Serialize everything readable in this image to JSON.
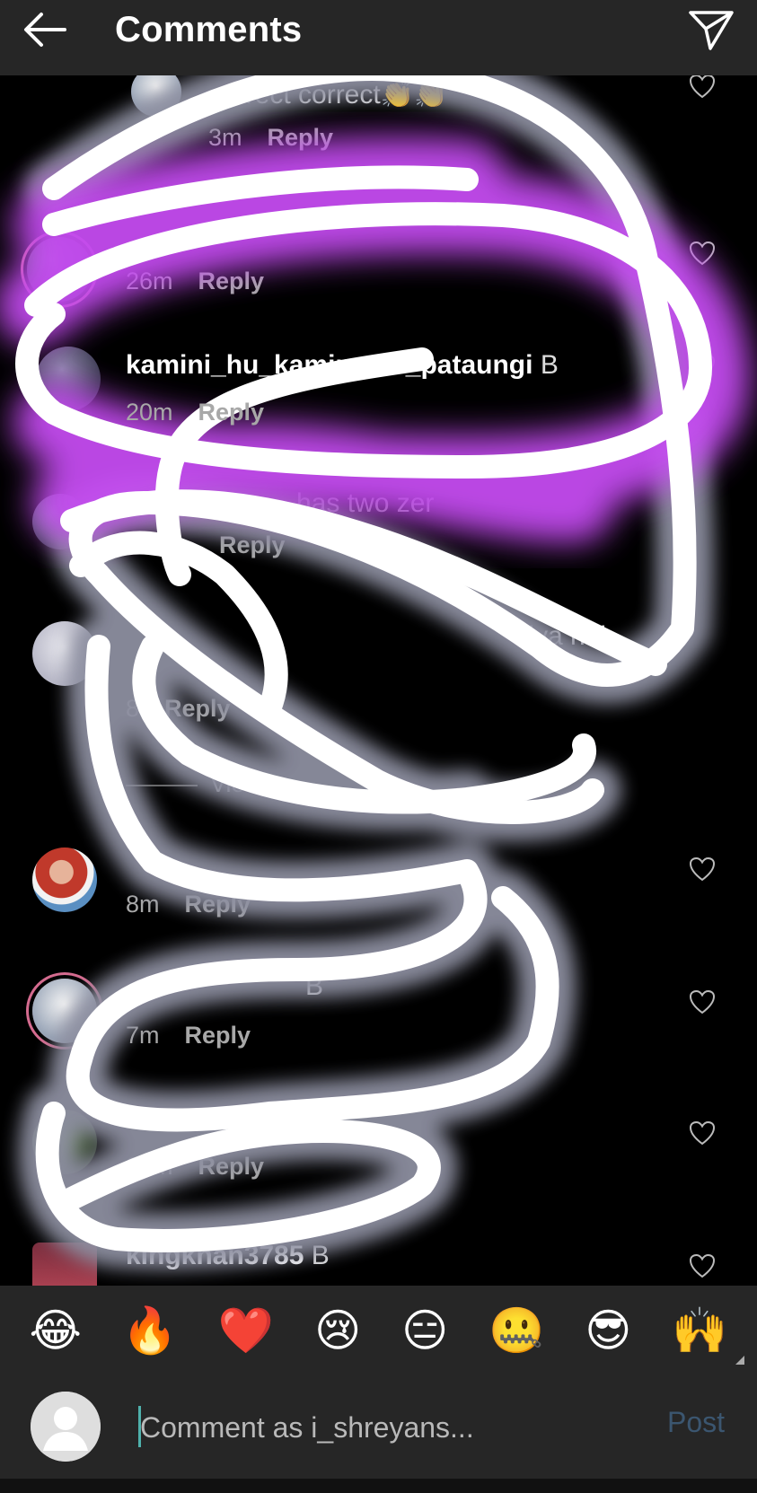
{
  "header": {
    "title": "Comments",
    "back_icon": "back-arrow-icon",
    "share_icon": "send-icon"
  },
  "comments": [
    {
      "username": "",
      "text": "correct correct👏👏",
      "time": "3m",
      "reply": "Reply"
    },
    {
      "username": "",
      "text": "",
      "time": "26m",
      "reply": "Reply"
    },
    {
      "username": "kamini_hu_kamina_hi_pataungi",
      "text": "B",
      "time": "20m",
      "reply": "Reply"
    },
    {
      "username": "",
      "text": "has two zer",
      "time": "",
      "reply": "Reply"
    },
    {
      "username": "",
      "text": "tiya nhi",
      "time": "8",
      "reply": "Reply",
      "view_replies": "View re"
    },
    {
      "username": "",
      "text": "",
      "time": "8m",
      "reply": "Reply"
    },
    {
      "username": "",
      "text": "B",
      "time": "7m",
      "reply": "Reply"
    },
    {
      "username": "",
      "text": "",
      "time": "20m",
      "reply": "Reply"
    },
    {
      "username": "kingkhan3785",
      "text": "B",
      "time": "",
      "reply": ""
    }
  ],
  "emoji_bar": [
    "😂",
    "🔥",
    "❤️",
    "😢",
    "😑",
    "🤐",
    "😎",
    "🙌"
  ],
  "composer": {
    "placeholder": "Comment as i_shreyans...",
    "post_label": "Post"
  },
  "colors": {
    "background": "#000000",
    "bar": "#262626",
    "scribble_white": "#ffffff",
    "scribble_glow": "#c44cf0",
    "post": "#3b5670"
  }
}
